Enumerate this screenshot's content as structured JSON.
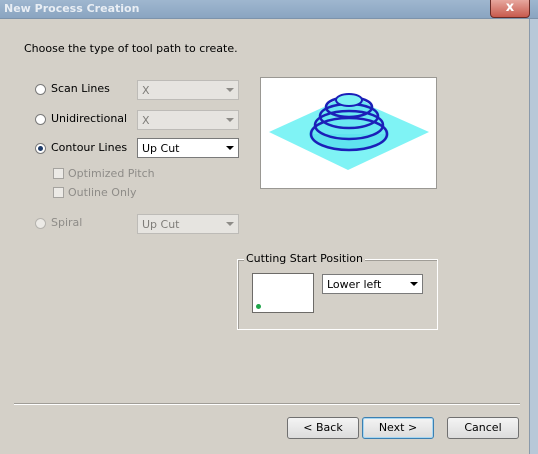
{
  "window": {
    "title": "New Process Creation",
    "close_glyph": "x"
  },
  "instruction": "Choose the type of tool path to create.",
  "options": {
    "scan_lines": {
      "label": "Scan Lines",
      "selected": false,
      "dropdown": "X"
    },
    "unidirectional": {
      "label": "Unidirectional",
      "selected": false,
      "dropdown": "X"
    },
    "contour_lines": {
      "label": "Contour Lines",
      "selected": true,
      "dropdown": "Up Cut"
    },
    "optimized_pitch": {
      "label": "Optimized Pitch",
      "checked": false
    },
    "outline_only": {
      "label": "Outline Only",
      "checked": false
    },
    "spiral": {
      "label": "Spiral",
      "selected": false,
      "dropdown": "Up Cut"
    }
  },
  "cutting_start": {
    "legend": "Cutting Start Position",
    "dropdown": "Lower left",
    "marker_color": "#1fa54a"
  },
  "preview": {
    "icon": "contour-toolpath-preview",
    "plane_color": "#7ff3f5",
    "dome_color": "#5fe3ef",
    "line_color": "#1b1fb8"
  },
  "buttons": {
    "back": "< Back",
    "next": "Next >",
    "cancel": "Cancel"
  }
}
